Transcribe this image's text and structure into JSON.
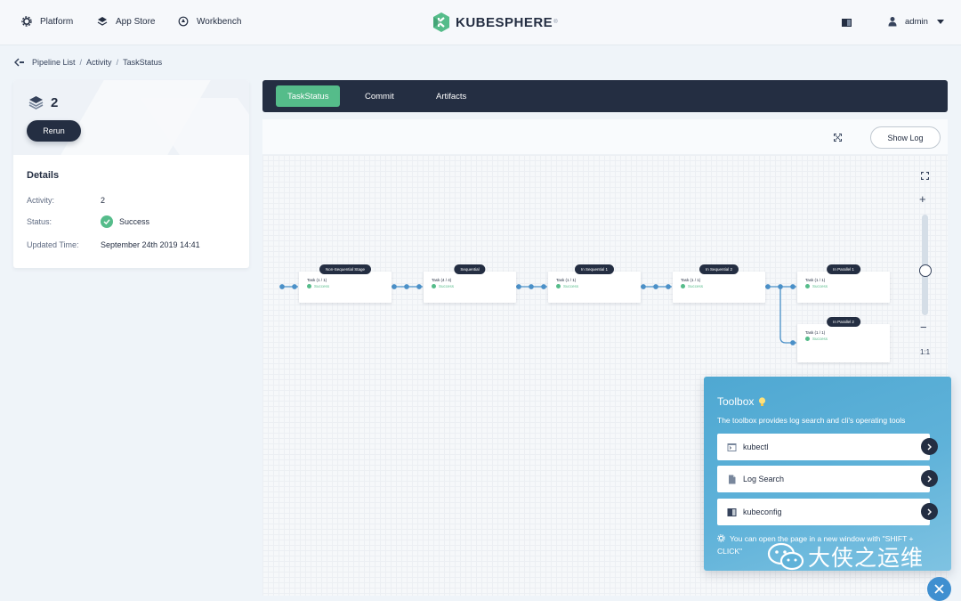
{
  "nav": {
    "items": [
      {
        "label": "Platform",
        "icon": "gear-icon"
      },
      {
        "label": "App Store",
        "icon": "appstore-icon"
      },
      {
        "label": "Workbench",
        "icon": "workbench-icon"
      }
    ],
    "logo_text": "KUBESPHERE",
    "logo_mark": "®",
    "user": "admin"
  },
  "breadcrumb": [
    "Pipeline List",
    "Activity",
    "TaskStatus"
  ],
  "run": {
    "number": "2",
    "rerun_label": "Rerun",
    "details_title": "Details",
    "fields": [
      {
        "key": "Activity:",
        "value": "2"
      },
      {
        "key": "Status:",
        "value": "Success"
      },
      {
        "key": "Updated Time:",
        "value": "September 24th 2019 14:41"
      }
    ]
  },
  "tabs": [
    "TaskStatus",
    "Commit",
    "Artifacts"
  ],
  "active_tab": "TaskStatus",
  "show_log_label": "Show Log",
  "zoom": {
    "plus": "+",
    "minus": "−",
    "ratio": "1:1"
  },
  "stages": [
    {
      "name": "Non-Sequential Stage",
      "task": "Task (1 / 1)",
      "status": "Success"
    },
    {
      "name": "Sequential",
      "task": "Task (4 / 4)",
      "status": "Success"
    },
    {
      "name": "In Sequential 1",
      "task": "Task (1 / 1)",
      "status": "Success"
    },
    {
      "name": "In Sequential 2",
      "task": "Task (1 / 1)",
      "status": "Success"
    },
    {
      "name": "In Parallel 1",
      "task": "Task (1 / 1)",
      "status": "Success"
    },
    {
      "name": "In Parallel 2",
      "task": "Task (1 / 1)",
      "status": "Success"
    }
  ],
  "toolbox": {
    "title": "Toolbox",
    "description": "The toolbox provides log search and cli's operating tools",
    "items": [
      {
        "label": "kubectl",
        "icon": "terminal-icon"
      },
      {
        "label": "Log Search",
        "icon": "document-icon"
      },
      {
        "label": "kubeconfig",
        "icon": "kubeconfig-icon"
      }
    ],
    "tip": "You can open the page in a new window with \"SHIFT + CLICK\"",
    "watermark": "大侠之运维"
  },
  "colors": {
    "dark": "#242e42",
    "success": "#55bc8a",
    "toolbox": "#5fb2d9",
    "link_line": "#4a90c8"
  }
}
